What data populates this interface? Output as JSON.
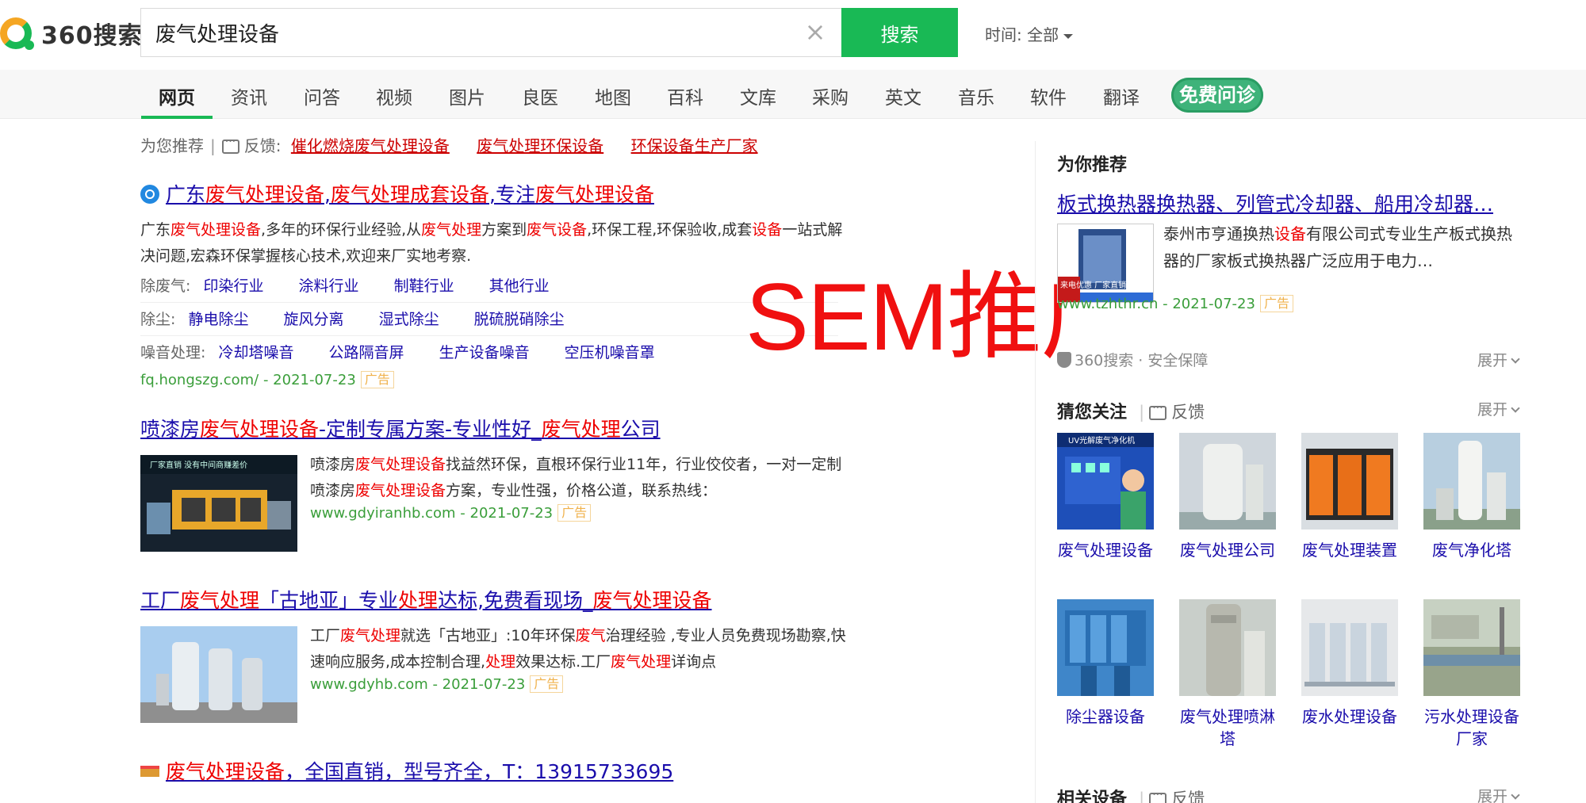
{
  "logo": {
    "text": "360搜索"
  },
  "search": {
    "query": "废气处理设备",
    "button_label": "搜索",
    "clear_icon": "close-icon"
  },
  "time_filter": {
    "label": "时间: 全部"
  },
  "tabs": [
    {
      "label": "网页",
      "active": true
    },
    {
      "label": "资讯"
    },
    {
      "label": "问答"
    },
    {
      "label": "视频"
    },
    {
      "label": "图片"
    },
    {
      "label": "良医"
    },
    {
      "label": "地图"
    },
    {
      "label": "百科"
    },
    {
      "label": "文库"
    },
    {
      "label": "采购"
    },
    {
      "label": "英文"
    },
    {
      "label": "音乐"
    },
    {
      "label": "软件"
    },
    {
      "label": "翻译"
    }
  ],
  "free_consult": {
    "label": "免费问诊"
  },
  "recommend": {
    "prefix": "为您推荐",
    "feedback": "反馈:",
    "links": [
      "催化燃烧废气处理设备",
      "废气处理环保设备",
      "环保设备生产厂家"
    ]
  },
  "results": [
    {
      "title": "广东废气处理设备,废气处理成套设备,专注废气处理设备",
      "desc": "广东废气处理设备,多年的环保行业经验,从废气处理方案到废气设备,环保工程,环保验收,成套设备一站式解决问题,宏森环保掌握核心技术,欢迎来厂实地考察.",
      "sublinks": [
        {
          "label": "除废气:",
          "items": [
            "印染行业",
            "涂料行业",
            "制鞋行业",
            "其他行业"
          ]
        },
        {
          "label": "除尘:",
          "items": [
            "静电除尘",
            "旋风分离",
            "湿式除尘",
            "脱硫脱硝除尘"
          ]
        },
        {
          "label": "噪音处理:",
          "items": [
            "冷却塔噪音",
            "公路隔音屏",
            "生产设备噪音",
            "空压机噪音罩"
          ]
        }
      ],
      "url": "fq.hongszg.com/ - 2021-07-23",
      "ad": "广告"
    },
    {
      "title": "喷漆房废气处理设备-定制专属方案-专业性好_废气处理公司",
      "desc": "喷漆房废气处理设备找益然环保，直根环保行业11年，行业佼佼者，一对一定制喷漆房废气处理设备方案，专业性强，价格公道，联系热线：",
      "url": "www.gdyiranhb.com - 2021-07-23",
      "ad": "广告",
      "thumb_text": "厂家直销 没有中间商赚差价"
    },
    {
      "title": "工厂废气处理「古地亚」专业处理达标,免费看现场_废气处理设备",
      "desc": "工厂废气处理就选「古地亚」:10年环保废气治理经验 ,专业人员免费现场勘察,快速响应服务,成本控制合理,处理效果达标.工厂废气处理详询点",
      "url": "www.gdyhb.com - 2021-07-23",
      "ad": "广告"
    },
    {
      "title": "废气处理设备，全国直销，型号齐全，T：13915733695"
    }
  ],
  "overlay": {
    "text": "SEM推广"
  },
  "right": {
    "rec_title": "为你推荐",
    "rec_link": "板式换热器换热器、列管式冷却器、船用冷却器…",
    "rec_desc": "泰州市亨通换热设备有限公司式专业生产板式换热器的厂家板式换热器广泛应用于电力…",
    "rec_url": "www.tzhthr.cn - 2021-07-23",
    "rec_ad": "广告",
    "rec_thumb_text": "来电优惠 厂家直销 品质保证",
    "safe": "360搜索 · 安全保障",
    "expand": "展开",
    "guess_title": "猜您关注",
    "feedback": "反馈",
    "guess_items": [
      {
        "label": "废气处理设备",
        "thumb_text": "UV光解废气净化机"
      },
      {
        "label": "废气处理公司"
      },
      {
        "label": "废气处理装置"
      },
      {
        "label": "废气净化塔"
      },
      {
        "label": "除尘器设备"
      },
      {
        "label": "废气处理喷淋塔"
      },
      {
        "label": "废水处理设备"
      },
      {
        "label": "污水处理设备厂家"
      }
    ],
    "related_title": "相关设备"
  },
  "colors": {
    "accent": "#19b955",
    "link": "#1a0dab",
    "highlight": "#e00000",
    "url": "#3a9e3a",
    "overlay": "#f01010"
  }
}
